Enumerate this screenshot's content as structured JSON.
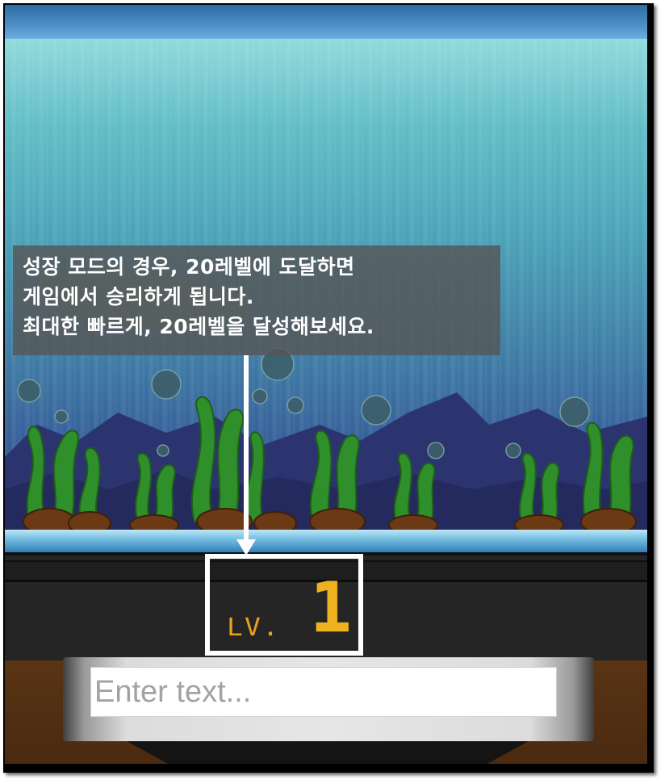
{
  "tutorial": {
    "lines": [
      "성장 모드의 경우, 20레벨에 도달하면",
      "게임에서 승리하게 됩니다.",
      "최대한 빠르게, 20레벨을 달성해보세요."
    ]
  },
  "level": {
    "label": "LV.",
    "value": "1"
  },
  "input": {
    "placeholder": "Enter text...",
    "value": ""
  },
  "icons": {
    "arrow": "arrow-down-icon"
  },
  "colors": {
    "level_text": "#f0b21f",
    "highlight_box": "#ffffff",
    "tooltip_bg": "#555555"
  }
}
